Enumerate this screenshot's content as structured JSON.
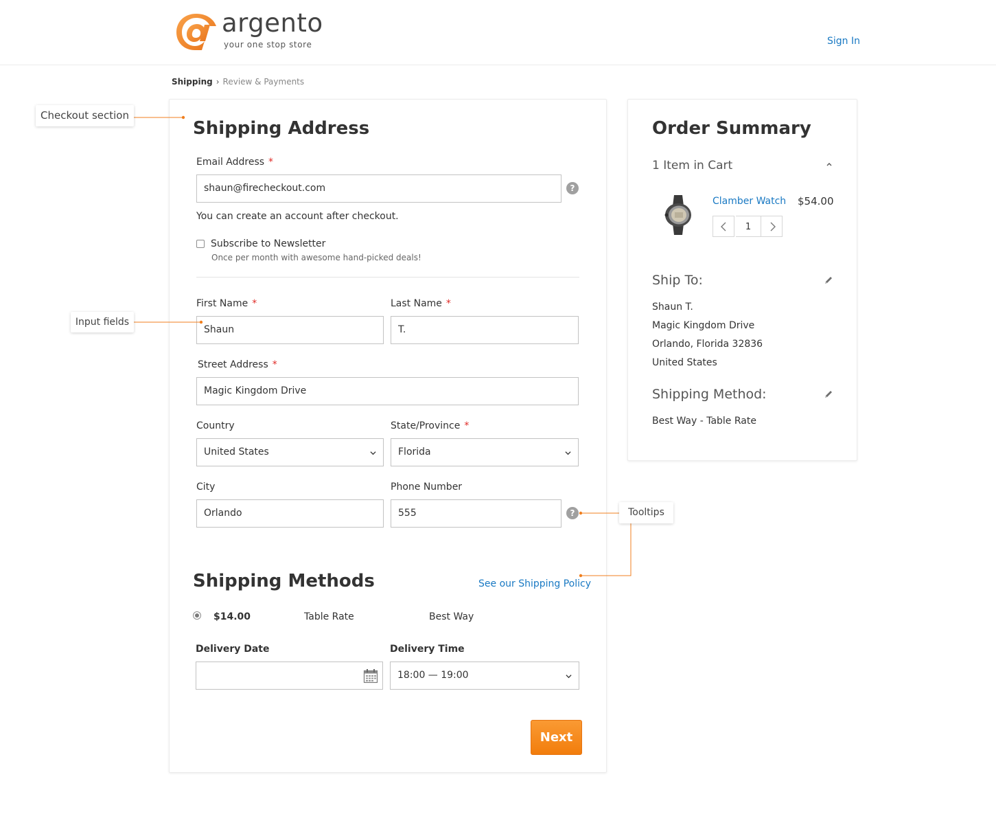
{
  "brand": {
    "name": "argento",
    "tagline": "your one stop store",
    "color": "#f07f1f"
  },
  "header": {
    "signin_label": "Sign In"
  },
  "breadcrumb": {
    "current": "Shipping",
    "separator": "›",
    "next": "Review & Payments"
  },
  "shipping_address": {
    "title": "Shipping Address",
    "email": {
      "label": "Email Address",
      "required": "*",
      "value": "shaun@firecheckout.com",
      "help": "?"
    },
    "account_note": "You can create an account after checkout.",
    "newsletter": {
      "label": "Subscribe to Newsletter",
      "note": "Once per month with awesome hand-picked deals!",
      "checked": false
    },
    "first_name": {
      "label": "First Name",
      "required": "*",
      "value": "Shaun"
    },
    "last_name": {
      "label": "Last Name",
      "required": "*",
      "value": "T."
    },
    "street": {
      "label": "Street Address",
      "required": "*",
      "value": "Magic Kingdom Drive"
    },
    "country": {
      "label": "Country",
      "value": "United States"
    },
    "state": {
      "label": "State/Province",
      "required": "*",
      "value": "Florida"
    },
    "city": {
      "label": "City",
      "value": "Orlando"
    },
    "phone": {
      "label": "Phone Number",
      "value": "555",
      "help": "?"
    }
  },
  "shipping_methods": {
    "title": "Shipping Methods",
    "policy_link": "See our Shipping Policy",
    "options": [
      {
        "price": "$14.00",
        "method": "Table Rate",
        "carrier": "Best Way",
        "selected": true
      }
    ],
    "delivery_date": {
      "label": "Delivery Date",
      "value": ""
    },
    "delivery_time": {
      "label": "Delivery Time",
      "value": "18:00 — 19:00"
    },
    "next_label": "Next",
    "accent_color": "#f68b1f"
  },
  "order_summary": {
    "title": "Order Summary",
    "cart_count": "1 Item in Cart",
    "item": {
      "name": "Clamber Watch",
      "price": "$54.00",
      "qty": "1"
    },
    "ship_to": {
      "title": "Ship To:",
      "lines": [
        "Shaun T.",
        "Magic Kingdom Drive",
        "Orlando, Florida 32836",
        "United States"
      ]
    },
    "shipping_method": {
      "title": "Shipping Method:",
      "value": "Best Way - Table Rate"
    }
  },
  "annotations": {
    "checkout_section": "Checkout section",
    "input_fields": "Input fields",
    "tooltips": "Tooltips",
    "line_color": "#f07f1f"
  }
}
